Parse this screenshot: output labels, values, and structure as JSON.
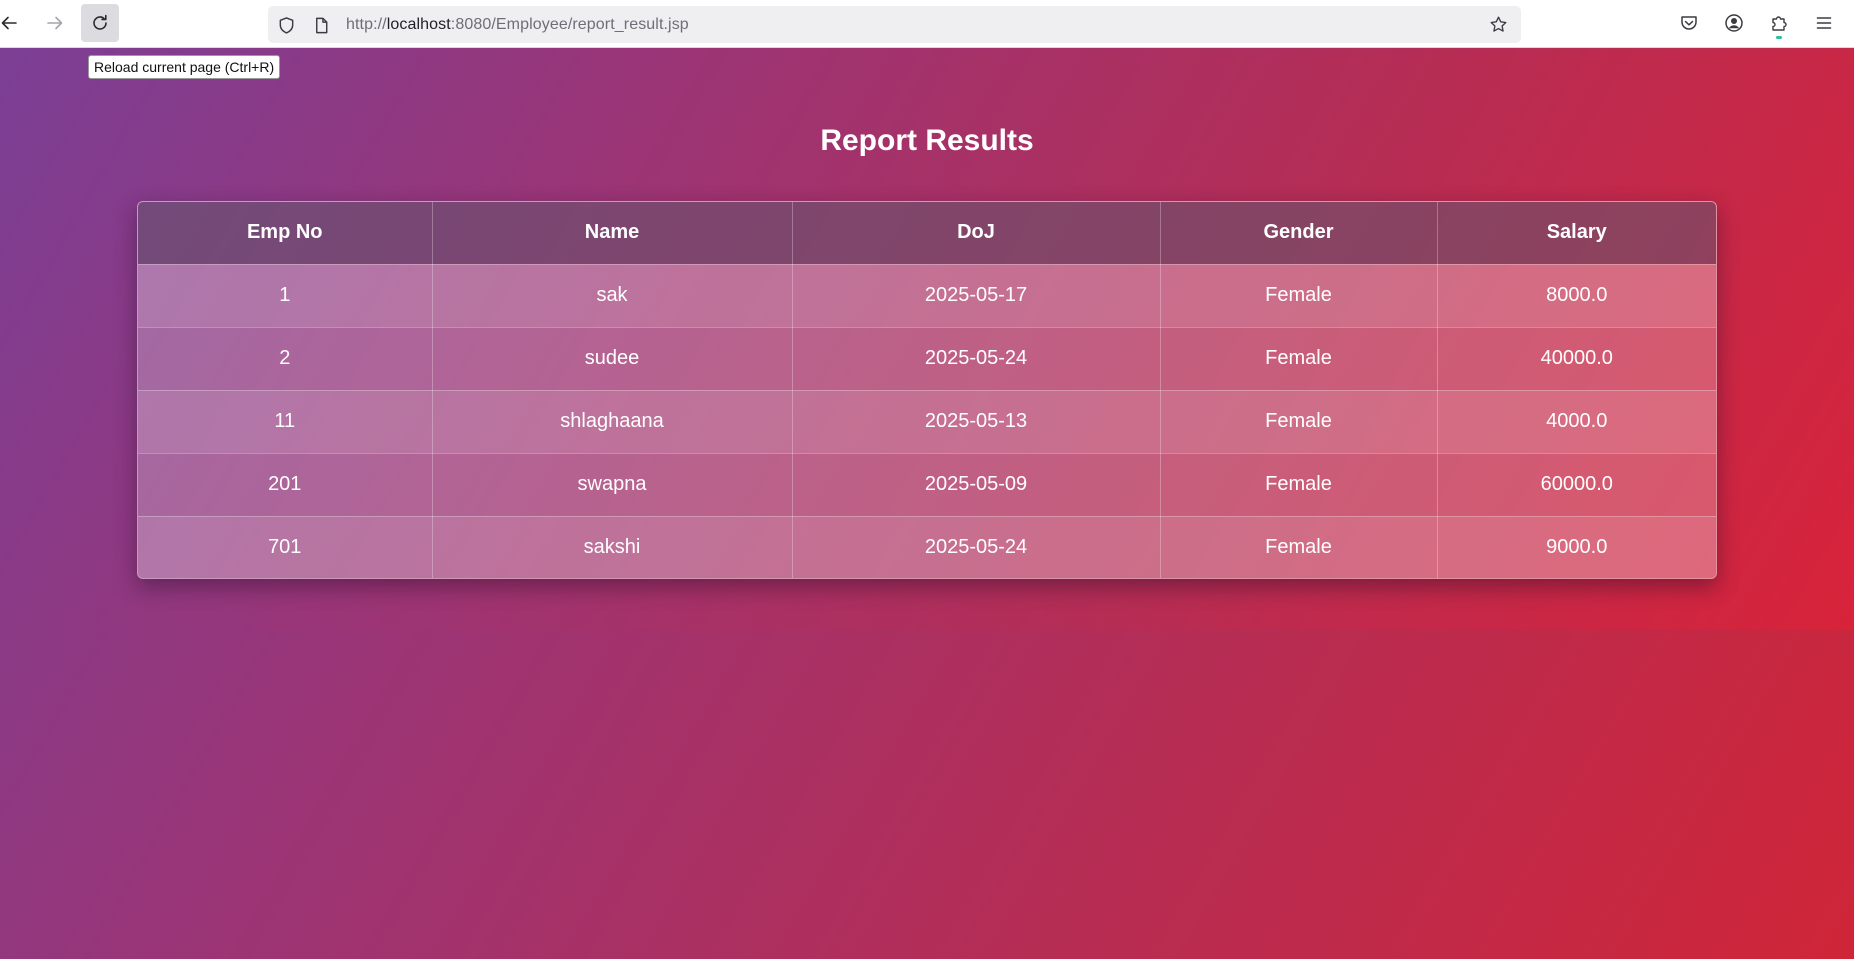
{
  "browser": {
    "url_prefix": "http://",
    "url_host": "localhost",
    "url_rest": ":8080/Employee/report_result.jsp",
    "tooltip": "Reload current page (Ctrl+R)",
    "icons": [
      "back-arrow-icon",
      "forward-arrow-icon",
      "reload-icon",
      "shield-icon",
      "page-icon",
      "star-icon",
      "pocket-icon",
      "account-icon",
      "extensions-icon",
      "menu-icon"
    ]
  },
  "page": {
    "title": "Report Results"
  },
  "table": {
    "columns": [
      "Emp No",
      "Name",
      "DoJ",
      "Gender",
      "Salary"
    ],
    "rows": [
      [
        "1",
        "sak",
        "2025-05-17",
        "Female",
        "8000.0"
      ],
      [
        "2",
        "sudee",
        "2025-05-24",
        "Female",
        "40000.0"
      ],
      [
        "11",
        "shlaghaana",
        "2025-05-13",
        "Female",
        "4000.0"
      ],
      [
        "201",
        "swapna",
        "2025-05-09",
        "Female",
        "60000.0"
      ],
      [
        "701",
        "sakshi",
        "2025-05-24",
        "Female",
        "9000.0"
      ]
    ]
  },
  "colors": {
    "gradient_start": "#7b3f95",
    "gradient_end": "#d8233a"
  }
}
